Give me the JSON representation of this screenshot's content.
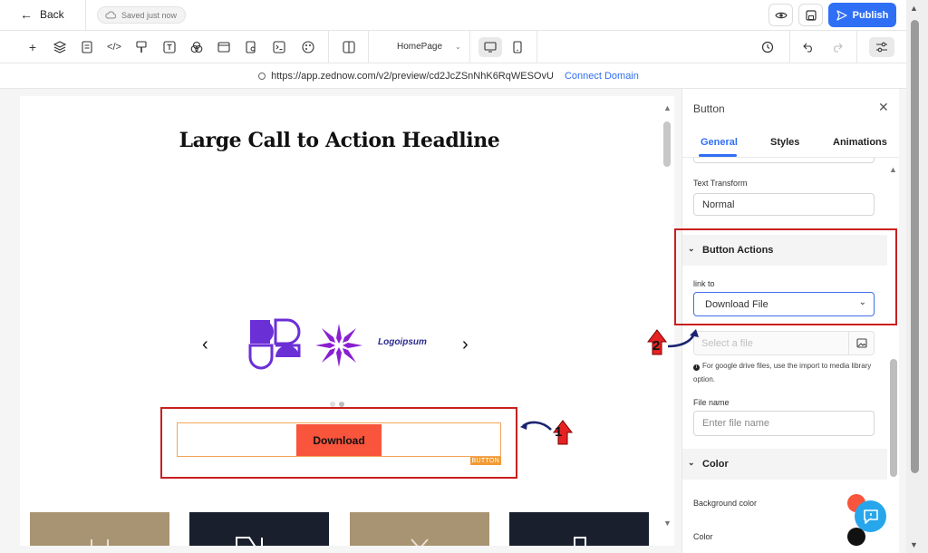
{
  "topbar": {
    "back_label": "Back",
    "saved_status": "Saved just now",
    "publish_label": "Publish"
  },
  "toolbar": {
    "page_select": "HomePage"
  },
  "url_bar": {
    "url": "https://app.zednow.com/v2/preview/cd2JcZSnNhK6RqWESOvU",
    "connect_label": "Connect Domain"
  },
  "canvas": {
    "headline": "Large Call to Action Headline",
    "logo_text": "Logoipsum",
    "download_label": "Download",
    "element_tag": "BUTTON",
    "thumb_colors": [
      "#a89472",
      "#1a1f2e",
      "#a89472",
      "#1a1f2e"
    ]
  },
  "annotations": {
    "marker_1": "1",
    "marker_2": "2",
    "highlight_color": "#c8201f"
  },
  "panel": {
    "title": "Button",
    "tabs": [
      "General",
      "Styles",
      "Animations"
    ],
    "active_tab": "General",
    "text_transform_label": "Text Transform",
    "text_transform_value": "Normal",
    "button_actions_header": "Button Actions",
    "link_to_label": "link to",
    "link_to_value": "Download File",
    "select_file_placeholder": "Select a file",
    "hint_text": "For google drive files, use the import to media library option.",
    "file_name_label": "File name",
    "file_name_placeholder": "Enter file name",
    "color_header": "Color",
    "bg_color_label": "Background color",
    "color_label": "Color",
    "bg_color_value": "#f9543c",
    "color_value": "#111111"
  },
  "colors": {
    "accent": "#2f6ff5",
    "button_bg": "#f9543c"
  }
}
